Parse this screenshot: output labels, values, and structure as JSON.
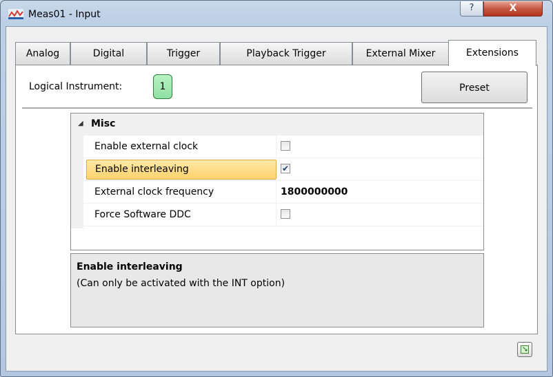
{
  "window": {
    "title": "Meas01 - Input",
    "help_glyph": "?",
    "close_glyph": "X"
  },
  "tabs": [
    {
      "label": "Analog"
    },
    {
      "label": "Digital"
    },
    {
      "label": "Trigger"
    },
    {
      "label": "Playback Trigger"
    },
    {
      "label": "External Mixer"
    },
    {
      "label": "Extensions",
      "active": true
    }
  ],
  "header": {
    "logical_instrument_label": "Logical Instrument:",
    "logical_instrument_value": "1",
    "preset_label": "Preset"
  },
  "grid": {
    "category": "Misc",
    "rows": [
      {
        "name": "Enable external clock",
        "type": "checkbox",
        "checked": false
      },
      {
        "name": "Enable interleaving",
        "type": "checkbox",
        "checked": true,
        "selected": true
      },
      {
        "name": "External clock frequency",
        "type": "text",
        "value": "1800000000"
      },
      {
        "name": "Force Software DDC",
        "type": "checkbox",
        "checked": false
      }
    ]
  },
  "description": {
    "title": "Enable interleaving",
    "text": "(Can only be activated with the INT option)"
  },
  "icons": {
    "app": "waveform-icon",
    "collapse": "triangle-down-icon",
    "check": "check-icon",
    "corner": "export-icon"
  },
  "colors": {
    "selection": "#ffd26e",
    "instrument_badge": "#8fe0a3",
    "close_button": "#c75a44"
  }
}
